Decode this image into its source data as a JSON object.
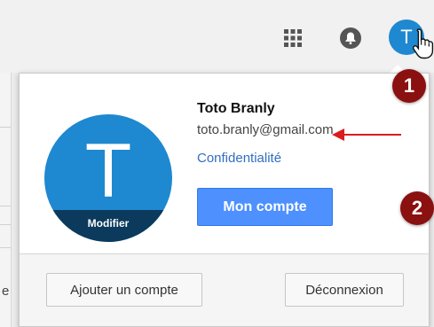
{
  "header": {
    "apps_icon": "apps-grid-icon",
    "notifications_icon": "bell-icon",
    "avatar_letter": "T"
  },
  "annotations": {
    "step1": "1",
    "step2": "2",
    "color": "#8b1010",
    "arrow_color": "#dd1c1c"
  },
  "account_panel": {
    "avatar_letter": "T",
    "avatar_modify_label": "Modifier",
    "name": "Toto Branly",
    "email": "toto.branly@gmail.com",
    "privacy_link": "Confidentialité",
    "account_button": "Mon compte",
    "add_account_button": "Ajouter un compte",
    "signout_button": "Déconnexion"
  },
  "background": {
    "partial_text": "e"
  },
  "colors": {
    "avatar_blue": "#1e88d0",
    "button_blue": "#4d90fe",
    "link_blue": "#2f6fc0"
  }
}
